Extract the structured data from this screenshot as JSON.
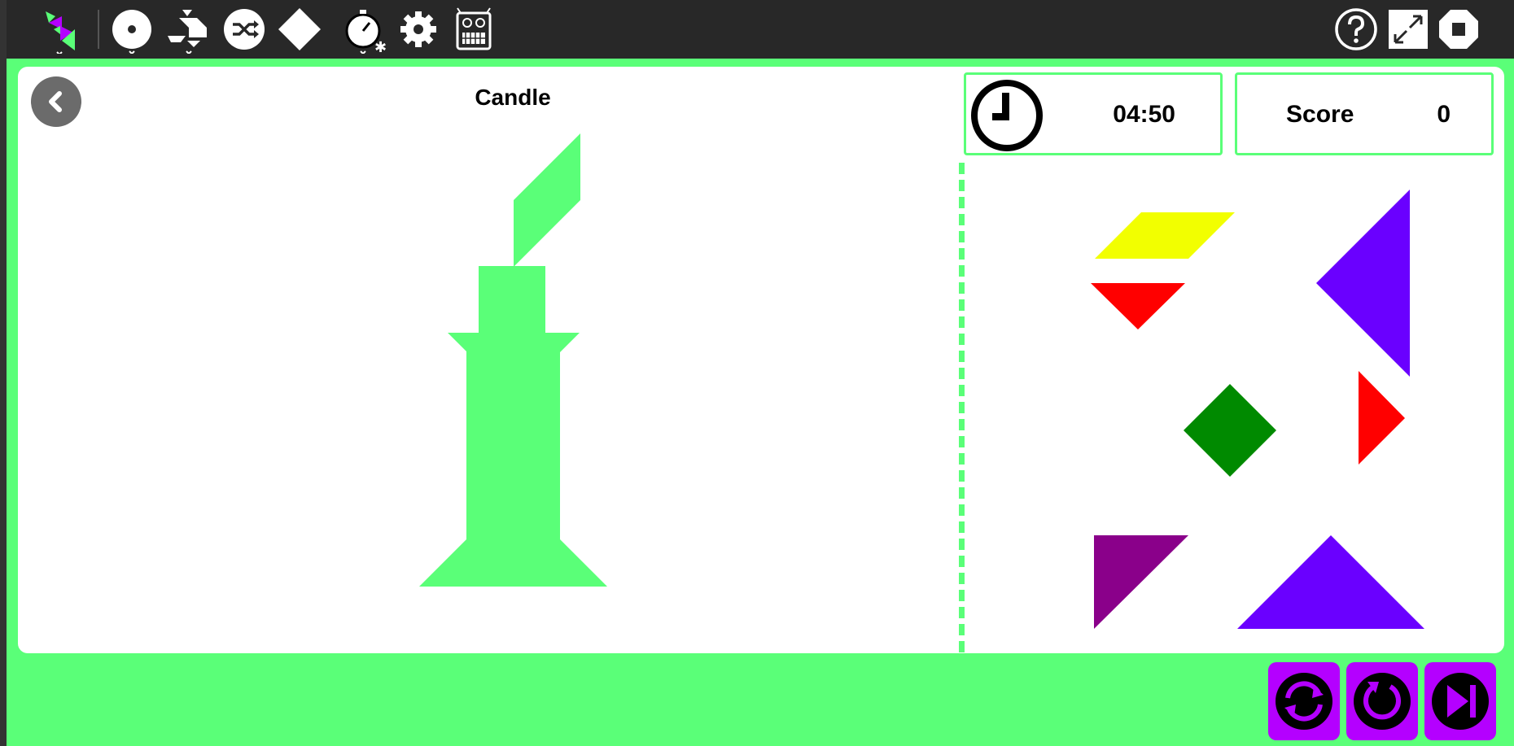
{
  "toolbar": {
    "icons": [
      "tangram-activity-icon",
      "level-select-icon",
      "level-category-icon",
      "shuffle-icon",
      "piece-shape-icon",
      "timer-icon",
      "settings-icon",
      "robot-icon",
      "help-icon",
      "fullscreen-icon",
      "stop-icon"
    ]
  },
  "puzzle": {
    "title": "Candle",
    "target_color": "#5aff78"
  },
  "timer": {
    "value": "04:50"
  },
  "score": {
    "label": "Score",
    "value": "0"
  },
  "pieces": [
    {
      "name": "yellow-parallelogram",
      "color": "#f2ff00"
    },
    {
      "name": "red-small-triangle-top",
      "color": "#ff0000"
    },
    {
      "name": "violet-large-triangle-right",
      "color": "#6a00ff"
    },
    {
      "name": "green-square",
      "color": "#008a00"
    },
    {
      "name": "red-small-triangle-right",
      "color": "#ff0000"
    },
    {
      "name": "purple-medium-triangle",
      "color": "#8a008a"
    },
    {
      "name": "violet-large-triangle-bottom",
      "color": "#6a00ff"
    }
  ],
  "bottom_controls": {
    "icons": [
      "flip-icon",
      "rotate-icon",
      "next-level-icon"
    ],
    "color": "#b400ff"
  }
}
